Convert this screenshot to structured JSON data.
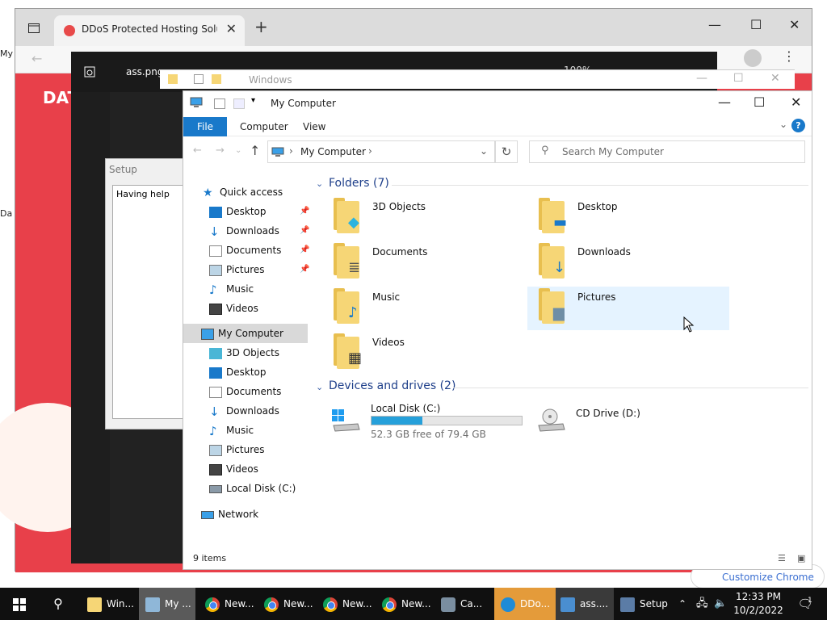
{
  "desktop": {
    "left_label_1": "My",
    "left_label_2": "Da"
  },
  "browser": {
    "tab_title": "DDoS Protected Hosting Solution",
    "tab_close": "✕",
    "new_tab": "+",
    "page_heading_fragment": "DAT",
    "customize_button": "Customize Chrome",
    "minimize": "—",
    "maximize": "☐",
    "close": "✕"
  },
  "photos": {
    "title": "ass.png",
    "zoom": "100%"
  },
  "setup_dialog": {
    "title": "Setup",
    "body_text": "Having help"
  },
  "back_explorer": {
    "title": "Windows"
  },
  "explorer": {
    "title": "My Computer",
    "ribbon": {
      "file": "File",
      "tabs": [
        "Computer",
        "View"
      ],
      "help": "?"
    },
    "address": {
      "crumb": "My Computer",
      "separator": "›"
    },
    "search_placeholder": "Search My Computer",
    "nav_pane": {
      "quick_access": "Quick access",
      "quick_items": [
        "Desktop",
        "Downloads",
        "Documents",
        "Pictures",
        "Music",
        "Videos"
      ],
      "this_pc": "My Computer",
      "pc_items": [
        "3D Objects",
        "Desktop",
        "Documents",
        "Downloads",
        "Music",
        "Pictures",
        "Videos",
        "Local Disk (C:)"
      ],
      "network": "Network"
    },
    "folders_header": "Folders (7)",
    "folders": [
      "3D Objects",
      "Desktop",
      "Documents",
      "Downloads",
      "Music",
      "Pictures",
      "Videos"
    ],
    "devices_header": "Devices and drives (2)",
    "drives": [
      {
        "name": "Local Disk (C:)",
        "free": "52.3 GB free of 79.4 GB",
        "used_fraction": 0.34
      },
      {
        "name": "CD Drive (D:)"
      }
    ],
    "status_items": "9 items"
  },
  "taskbar": {
    "items": [
      "Win...",
      "My ...",
      "New...",
      "New...",
      "New...",
      "New...",
      "Ca...",
      "DDo...",
      "ass....",
      "Setup"
    ],
    "time": "12:33 PM",
    "date": "10/2/2022",
    "notif_count": "1"
  },
  "colors": {
    "accent": "#1979ca",
    "page_red": "#e8404a",
    "drive_bar": "#26a0da",
    "taskbar_highlight": "#e49b3a"
  }
}
